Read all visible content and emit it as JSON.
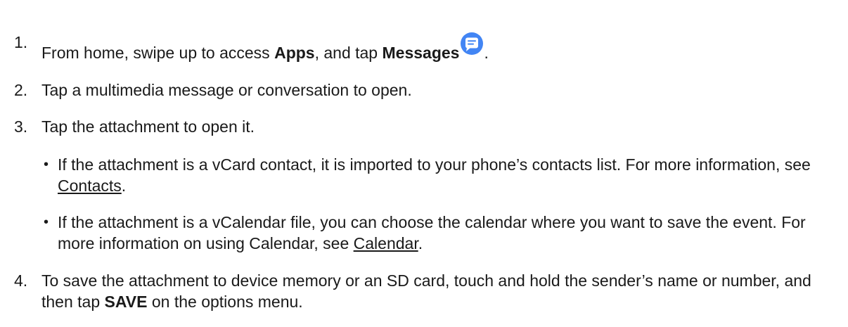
{
  "steps": [
    {
      "number": "1.",
      "text_before": "From home, swipe up to access ",
      "bold_apps": "Apps",
      "text_middle": ", and tap ",
      "bold_messages": "Messages",
      "text_after": "."
    },
    {
      "number": "2.",
      "text": "Tap a multimedia message or conversation to open."
    },
    {
      "number": "3.",
      "text": "Tap the attachment to open it.",
      "bullets": [
        {
          "marker": "•",
          "text": "If the attachment is a vCard contact, it is imported to your phone’s contacts list. For more information, see ",
          "link": "Contacts",
          "after": "."
        },
        {
          "marker": "•",
          "text": "If the attachment is a vCalendar file, you can choose the calendar where you want to save the event. For more information on using Calendar, see ",
          "link": "Calendar",
          "after": "."
        }
      ]
    },
    {
      "number": "4.",
      "text_before": "To save the attachment to device memory or an SD card, touch and hold the sender’s name or number, and then tap ",
      "bold_save": "SAVE",
      "text_after": " on the options menu."
    }
  ],
  "icons": {
    "messages_icon": "messages-app-icon",
    "messages_icon_color": "#4285f4"
  }
}
